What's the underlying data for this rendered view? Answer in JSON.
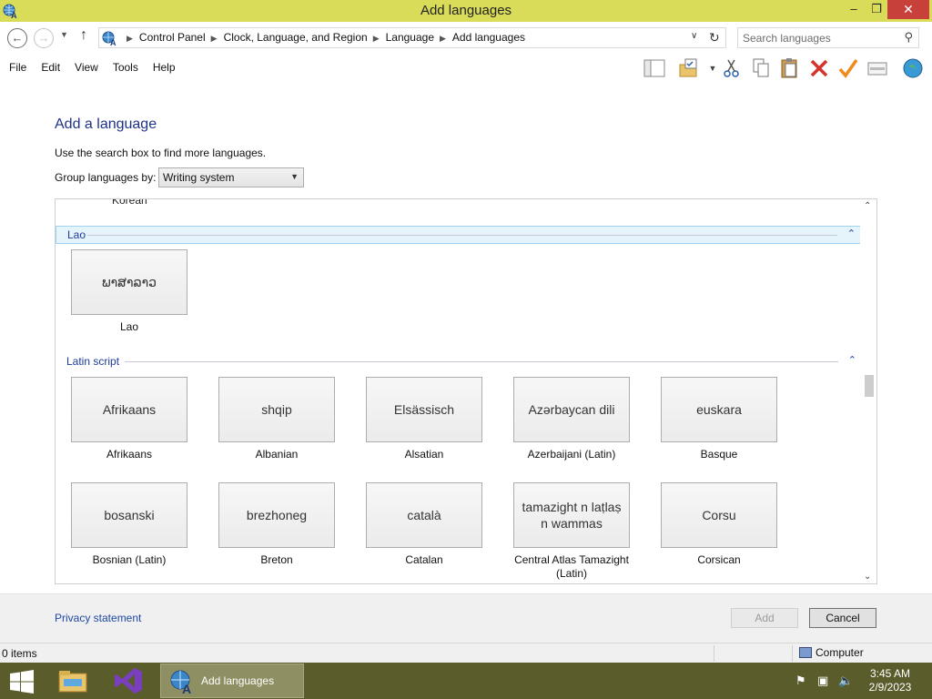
{
  "window": {
    "title": "Add languages",
    "min_glyph": "–",
    "max_glyph": "❐",
    "close_glyph": "✕"
  },
  "address": {
    "breadcrumbs": [
      "Control Panel",
      "Clock, Language, and Region",
      "Language",
      "Add languages"
    ],
    "search_placeholder": "Search languages"
  },
  "menu": {
    "items": [
      "File",
      "Edit",
      "View",
      "Tools",
      "Help"
    ]
  },
  "toolbar": {
    "icons": [
      "layout-pane-icon",
      "folder-check-icon",
      "cut-icon",
      "copy-icon",
      "paste-icon",
      "delete-icon",
      "checkmark-icon",
      "properties-icon",
      "globe-icon"
    ]
  },
  "page": {
    "heading": "Add a language",
    "hint": "Use the search box to find more languages.",
    "group_label": "Group languages by:",
    "group_value": "Writing system"
  },
  "list": {
    "partial_item": "Korean",
    "groups": [
      {
        "name": "Lao",
        "selected": true,
        "tiles": [
          {
            "native": "ພາສາລາວ",
            "english": "Lao"
          }
        ]
      },
      {
        "name": "Latin script",
        "selected": false,
        "tiles": [
          {
            "native": "Afrikaans",
            "english": "Afrikaans"
          },
          {
            "native": "shqip",
            "english": "Albanian"
          },
          {
            "native": "Elsässisch",
            "english": "Alsatian"
          },
          {
            "native": "Azərbaycan dili",
            "english": "Azerbaijani (Latin)"
          },
          {
            "native": "euskara",
            "english": "Basque"
          },
          {
            "native": "bosanski",
            "english": "Bosnian (Latin)"
          },
          {
            "native": "brezhoneg",
            "english": "Breton"
          },
          {
            "native": "català",
            "english": "Catalan"
          },
          {
            "native": "tamazight n laṭlaṣ n wammas",
            "english": "Central Atlas Tamazight (Latin)"
          },
          {
            "native": "Corsu",
            "english": "Corsican"
          }
        ]
      }
    ]
  },
  "footer": {
    "privacy_link": "Privacy statement",
    "add_label": "Add",
    "cancel_label": "Cancel"
  },
  "statusbar": {
    "items_text": "0 items",
    "location": "Computer"
  },
  "taskbar": {
    "active_window_label": "Add languages",
    "time": "3:45 AM",
    "date": "2/9/2023"
  },
  "colors": {
    "titlebar": "#d8dc59",
    "taskbar": "#5b5c2c",
    "link": "#1e47a6",
    "heading": "#1e3287"
  }
}
